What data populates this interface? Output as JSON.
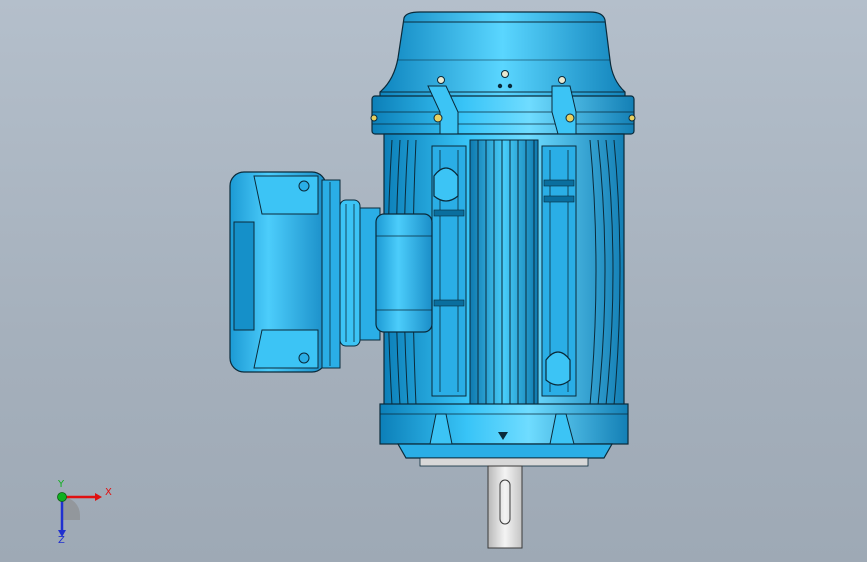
{
  "viewport": {
    "background_top": "#b4bfcb",
    "background_bottom": "#9ea9b5"
  },
  "model": {
    "body_color": "#2fb6ee",
    "edge_color": "#0a2a3a",
    "shaft_color": "#e6e6e6"
  },
  "triad": {
    "x_label": "X",
    "y_label": "Y",
    "z_label": "Z",
    "x_color": "#e01010",
    "y_color": "#10b020",
    "z_color": "#2030d0"
  }
}
